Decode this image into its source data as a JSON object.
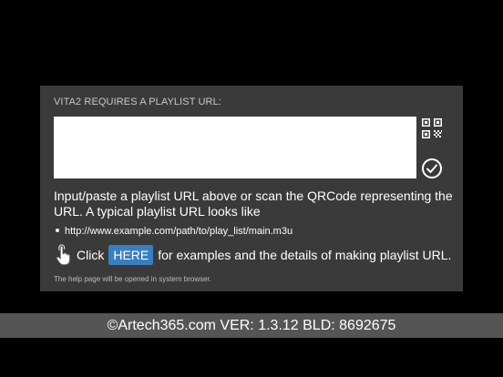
{
  "dialog": {
    "title": "VITA2 REQUIRES A PLAYLIST URL:",
    "url_input": {
      "value": "",
      "placeholder": ""
    },
    "qr_icon": "qr-code-icon",
    "confirm_icon": "checkmark-circle-icon",
    "instructions": "Input/paste a playlist URL above or scan the QRCode representing the URL. A typical playlist URL looks like",
    "example_url": "http://www.example.com/path/to/play_list/main.m3u",
    "click_prefix": "Click",
    "here_label": "HERE",
    "click_suffix": "for examples and the details of making playlist URL.",
    "hand_icon": "pointing-hand-icon",
    "footnote": "The help page will be opened in system browser."
  },
  "footer": {
    "text": "©Artech365.com VER: 1.3.12 BLD: 8692675"
  },
  "colors": {
    "background": "#000000",
    "dialog_bg": "#3a3a3a",
    "accent": "#3b7ec0",
    "footer_bg": "#555555"
  }
}
